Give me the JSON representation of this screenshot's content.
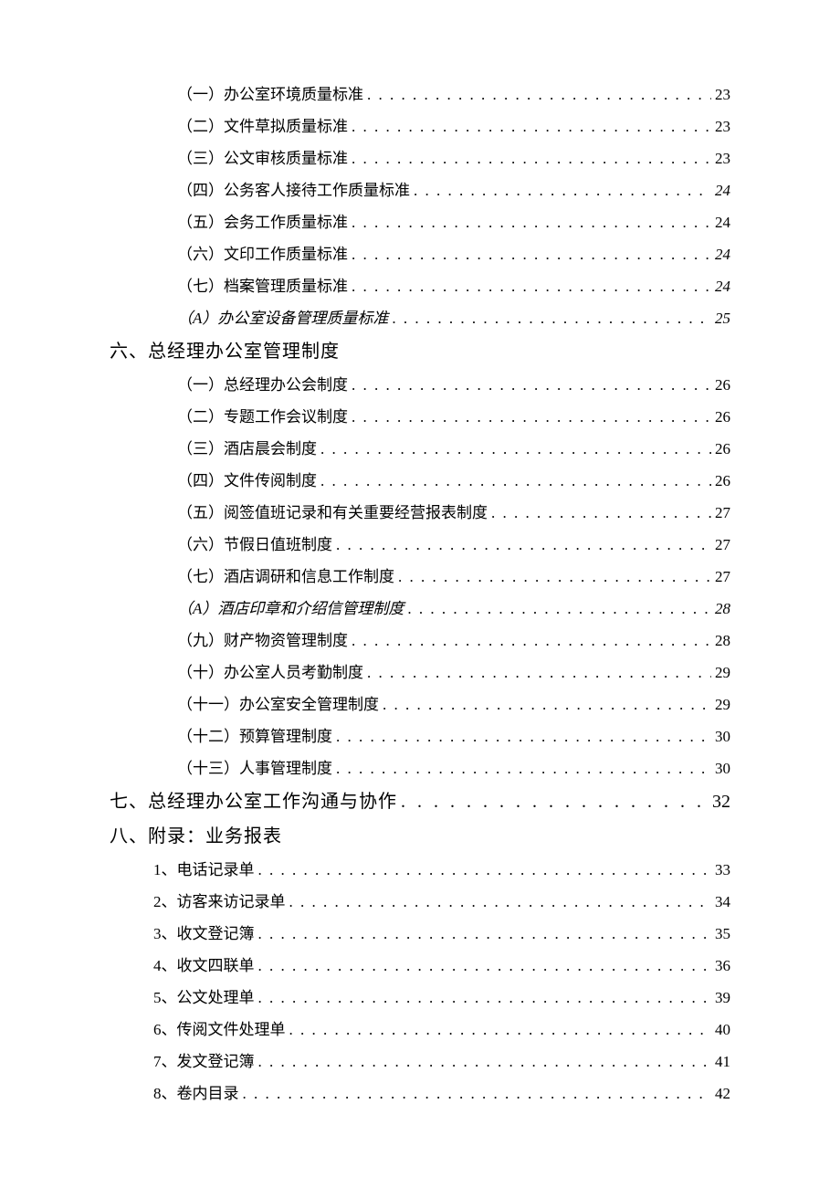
{
  "toc": [
    {
      "type": "sub",
      "label": "（一）办公室环境质量标准",
      "page": "23",
      "italic": false
    },
    {
      "type": "sub",
      "label": "（二）文件草拟质量标准",
      "page": "23",
      "italic": false
    },
    {
      "type": "sub",
      "label": "（三）公文审核质量标准",
      "page": "23",
      "italic": false
    },
    {
      "type": "sub",
      "label": "（四）公务客人接待工作质量标准",
      "page": "24",
      "italic": true
    },
    {
      "type": "sub",
      "label": "（五）会务工作质量标准",
      "page": "24",
      "italic": false
    },
    {
      "type": "sub",
      "label": "（六）文印工作质量标准",
      "page": "24",
      "italic": true
    },
    {
      "type": "sub",
      "label": "（七）档案管理质量标准",
      "page": "24",
      "italic": true
    },
    {
      "type": "sub",
      "label": "（A）办公室设备管理质量标准",
      "page": "25",
      "italic": true,
      "labelItalic": true
    },
    {
      "type": "head",
      "label": "六、总经理办公室管理制度",
      "page": ""
    },
    {
      "type": "sub",
      "label": "（一）总经理办公会制度",
      "page": "26",
      "italic": false
    },
    {
      "type": "sub",
      "label": "（二）专题工作会议制度",
      "page": "26",
      "italic": false
    },
    {
      "type": "sub",
      "label": "（三）酒店晨会制度",
      "page": "26",
      "italic": false
    },
    {
      "type": "sub",
      "label": "（四）文件传阅制度",
      "page": "26",
      "italic": false
    },
    {
      "type": "sub",
      "label": "（五）阅签值班记录和有关重要经营报表制度",
      "page": "27",
      "italic": false
    },
    {
      "type": "sub",
      "label": "（六）节假日值班制度",
      "page": "27",
      "italic": false
    },
    {
      "type": "sub",
      "label": "（七）酒店调研和信息工作制度",
      "page": "27",
      "italic": false
    },
    {
      "type": "sub",
      "label": "（A）酒店印章和介绍信管理制度",
      "page": "28",
      "italic": true,
      "labelItalic": true
    },
    {
      "type": "sub",
      "label": "（九）财产物资管理制度",
      "page": "28",
      "italic": false
    },
    {
      "type": "sub",
      "label": "（十）办公室人员考勤制度",
      "page": "29",
      "italic": false
    },
    {
      "type": "sub",
      "label": "（十一）办公室安全管理制度",
      "page": "29",
      "italic": false
    },
    {
      "type": "sub",
      "label": "（十二）预算管理制度",
      "page": "30",
      "italic": false
    },
    {
      "type": "sub",
      "label": "（十三）人事管理制度",
      "page": "30",
      "italic": false
    },
    {
      "type": "headp",
      "label": "七、总经理办公室工作沟通与协作 ",
      "page": "32"
    },
    {
      "type": "head",
      "label": "八、附录：业务报表",
      "page": ""
    },
    {
      "type": "sub2",
      "label": "1、电话记录单",
      "page": "33"
    },
    {
      "type": "sub2",
      "label": "2、访客来访记录单",
      "page": "34"
    },
    {
      "type": "sub2",
      "label": "3、收文登记簿",
      "page": "35"
    },
    {
      "type": "sub2",
      "label": "4、收文四联单",
      "page": "36"
    },
    {
      "type": "sub2",
      "label": "5、公文处理单",
      "page": "39"
    },
    {
      "type": "sub2",
      "label": "6、传阅文件处理单",
      "page": "40"
    },
    {
      "type": "sub2",
      "label": "7、发文登记簿",
      "page": "41"
    },
    {
      "type": "sub2",
      "label": "8、卷内目录",
      "page": "42"
    }
  ],
  "dotfill": ". . . . . . . . . . . . . . . . . . . . . . . . . . . . . . . . . . . . . . . . . . . . . . . . . . . . . . . . . . . . . . . . . . . . . . . . . . . . . . . . . . . . . . . . . . . . . . . . . . . . . . . . . . . . . . . . . . . . . . . ."
}
